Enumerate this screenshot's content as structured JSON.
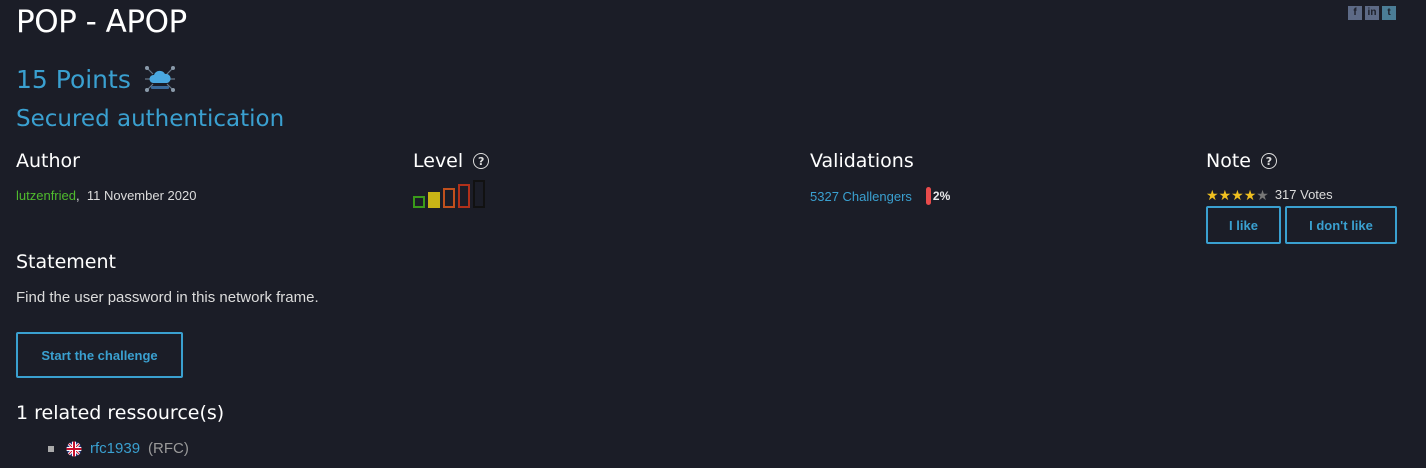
{
  "header": {
    "title": "POP - APOP",
    "points": "15 Points",
    "subtitle": "Secured authentication",
    "category_icon": "network-cloud-icon",
    "share": {
      "facebook": "f",
      "linkedin": "in",
      "twitter": "t"
    }
  },
  "author": {
    "heading": "Author",
    "name": "lutzenfried",
    "separator": ",",
    "date": "11 November 2020"
  },
  "level": {
    "heading": "Level",
    "help": "?",
    "value": 2,
    "max": 5,
    "colors": [
      "#3a9a1a",
      "#c8b416",
      "#c1501d",
      "#b1301a",
      "#111111"
    ]
  },
  "validations": {
    "heading": "Validations",
    "challengers": "5327 Challengers",
    "percent_label": "2%",
    "percent_color": "#e84b4b"
  },
  "note": {
    "heading": "Note",
    "help": "?",
    "stars_filled": 4,
    "stars_total": 5,
    "votes": "317 Votes",
    "like_label": "I like",
    "dislike_label": "I don't like"
  },
  "statement": {
    "heading": "Statement",
    "text": "Find the user password in this network frame.",
    "start_label": "Start the challenge"
  },
  "resources": {
    "heading": "1 related ressource(s)",
    "items": [
      {
        "flag": "uk-flag-icon",
        "link": "rfc1939",
        "type": "(RFC)"
      }
    ]
  },
  "colors": {
    "background": "#1b1d27",
    "accent": "#3aa0d0",
    "author_green": "#4fbb2e"
  }
}
